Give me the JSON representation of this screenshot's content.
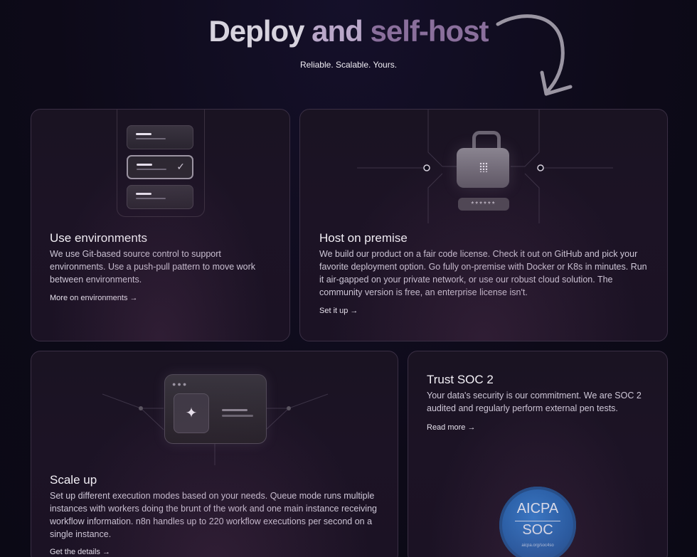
{
  "hero": {
    "title_part1": "Deploy",
    "title_part2": "and",
    "title_part3": "self-host",
    "subtitle": "Reliable. Scalable. Yours."
  },
  "cards": {
    "environments": {
      "title": "Use environments",
      "body": "We use Git-based source control to support environments. Use a push-pull pattern to move work between environments.",
      "link": "More on environments →"
    },
    "premise": {
      "title": "Host on premise",
      "body": "We build our product on a fair code license. Check it out on GitHub and pick your favorite deployment option. Go fully on-premise with Docker or K8s in minutes. Run it air-gapped on your private network, or use our robust cloud solution. The community version is free, an enterprise license isn't.",
      "link": "Set it up →",
      "password_mask": "******"
    },
    "scale": {
      "title": "Scale up",
      "body": "Set up different execution modes based on your needs. Queue mode runs multiple instances with workers doing the brunt of the work and one main instance receiving workflow information. n8n handles up to 220 workflow executions per second on a single instance.",
      "link": "Get the details →",
      "window_dots": "●●●",
      "tile_glyph": "✦"
    },
    "soc": {
      "title": "Trust SOC 2",
      "body": "Your data's security is our commitment. We are SOC 2 audited and regularly perform external pen tests.",
      "link": "Read more →",
      "badge_top": "AICPA",
      "badge_bottom": "SOC",
      "badge_url": "aicpa.org/soc4so"
    }
  },
  "icons": {
    "check": "✓",
    "arrow": "curved-arrow-icon",
    "lock": "lock-icon",
    "sparkle": "sparkle-icon"
  },
  "colors": {
    "background": "#0e0b1a",
    "card_border": "#3a2f44",
    "badge_blue": "#1e5ea8"
  }
}
